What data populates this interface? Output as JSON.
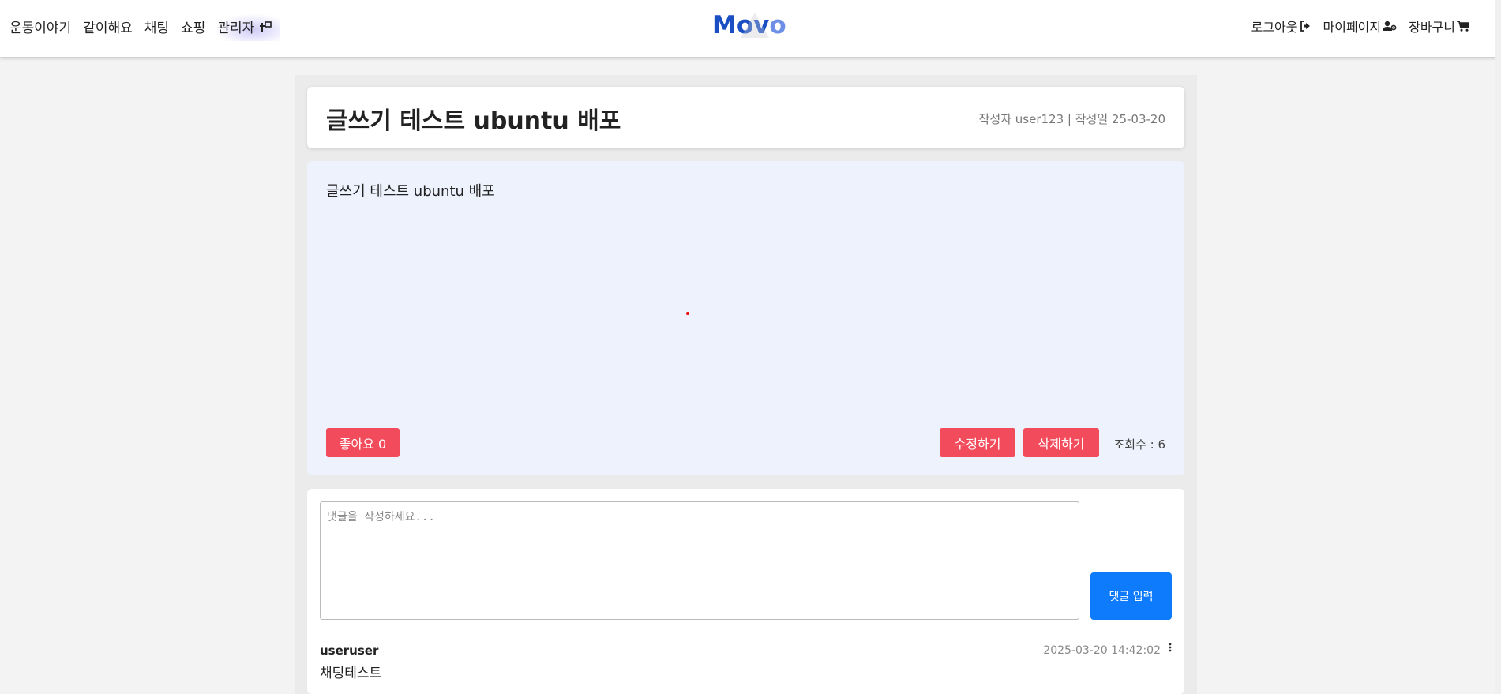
{
  "nav": {
    "left": [
      "운동이야기",
      "같이해요",
      "채팅",
      "쇼핑"
    ],
    "admin": "관리자",
    "logo": {
      "m": "M",
      "o1": "o",
      "v": "v",
      "o2": "o"
    },
    "right": {
      "logout": "로그아웃",
      "mypage": "마이페이지",
      "cart": "장바구니"
    }
  },
  "post": {
    "title": "글쓰기 테스트 ubuntu 배포",
    "meta": "작성자 user123 | 작성일 25-03-20",
    "body": "글쓰기 테스트 ubuntu 배포",
    "like_label": "좋아요 0",
    "edit_label": "수정하기",
    "delete_label": "삭제하기",
    "views": "조회수 : 6"
  },
  "comment_form": {
    "placeholder": "댓글을 작성하세요...",
    "submit_label": "댓글 입력"
  },
  "comments": [
    {
      "author": "useruser",
      "date": "2025-03-20 14:42:02",
      "text": "채팅테스트"
    }
  ],
  "colors": {
    "danger": "#f24c5c",
    "primary": "#0d7bfb",
    "logo": "#1a4fc4"
  }
}
